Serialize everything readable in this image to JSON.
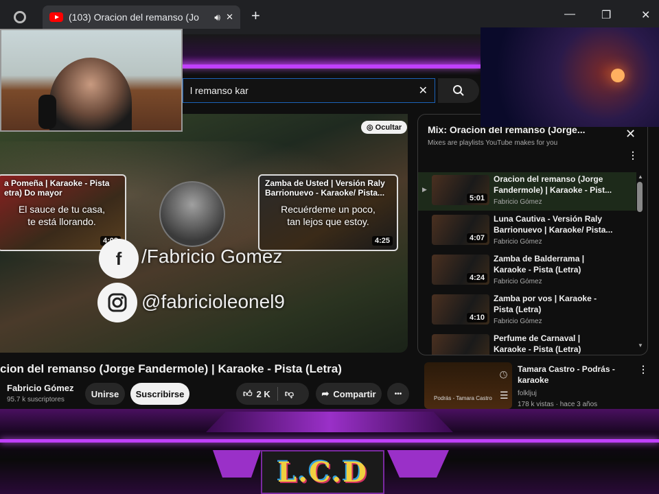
{
  "browser": {
    "tab_title": "(103) Oracion del remanso (Jo",
    "new_tab": "+",
    "minimize": "—",
    "restore": "❐",
    "close": "✕"
  },
  "search": {
    "value": "l remanso kar",
    "clear": "✕"
  },
  "player": {
    "hide_label": "Ocultar",
    "endcard_left": {
      "title": "a Pomeña | Karaoke - Pista\netra) Do mayor",
      "lyric": "El sauce de tu casa,\nte está llorando.",
      "duration": "4:08"
    },
    "endcard_right": {
      "title": "Zamba de Usted | Versión Raly\nBarrionuevo - Karaoke/ Pista...",
      "lyric": "Recuérdeme un poco,\ntan lejos que estoy.",
      "duration": "4:25"
    },
    "social_facebook": "/Fabricio Gomez",
    "social_instagram": "@fabricioleonel9"
  },
  "video": {
    "title": "cion del remanso (Jorge Fandermole) | Karaoke - Pista (Letra)",
    "channel": "Fabricio Gómez",
    "subscribers": "95.7 k suscriptores",
    "join": "Unirse",
    "subscribe": "Suscribirse",
    "likes": "2 K",
    "share": "Compartir",
    "more": "•••"
  },
  "playlist": {
    "title": "Mix: Oracion del remanso (Jorge...",
    "subtitle": "Mixes are playlists YouTube makes for you",
    "items": [
      {
        "title": "Oracion del remanso (Jorge Fandermole) | Karaoke - Pist...",
        "channel": "Fabricio Gómez",
        "duration": "5:01",
        "playing": true
      },
      {
        "title": "Luna Cautiva - Versión Raly Barrionuevo | Karaoke/ Pista...",
        "channel": "Fabricio Gómez",
        "duration": "4:07"
      },
      {
        "title": "Zamba de Balderrama | Karaoke - Pista (Letra)",
        "channel": "Fabricio Gómez",
        "duration": "4:24"
      },
      {
        "title": "Zamba por vos | Karaoke - Pista (Letra)",
        "channel": "Fabricio Gómez",
        "duration": "4:10"
      },
      {
        "title": "Perfume de Carnaval | Karaoke - Pista (Letra)",
        "channel": "",
        "duration": ""
      }
    ]
  },
  "recommendation": {
    "title": "Tamara Castro - Podrás - karaoke",
    "channel": "folkljuj",
    "meta": "178 k vistas · hace 3 años",
    "thumb_caption": "Podrás - Tamara Castro"
  },
  "overlay": {
    "logo_text": "L.C.D"
  },
  "colors": {
    "accent_purple": "#c040ff",
    "youtube_red": "#ff0000",
    "playlist_active": "#1d2a1a"
  }
}
